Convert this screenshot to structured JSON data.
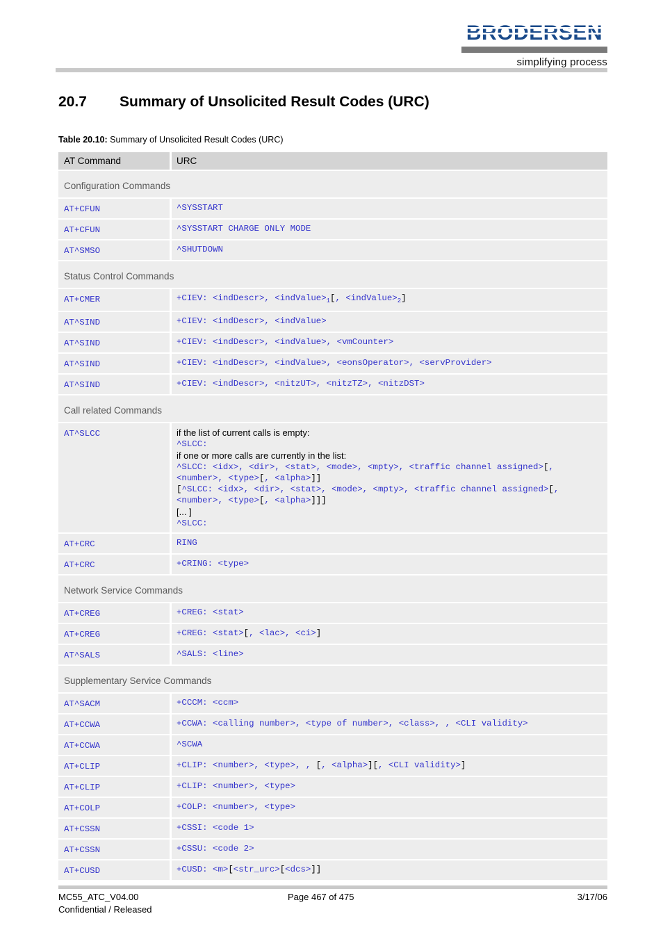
{
  "header": {
    "logo_text": "BRODERSEN",
    "logo_tagline": "simplifying process"
  },
  "title": {
    "number": "20.7",
    "text": "Summary of Unsolicited Result Codes (URC)"
  },
  "caption": {
    "label": "Table 20.10:",
    "text": "Summary of Unsolicited Result Codes (URC)"
  },
  "table": {
    "columns": [
      "AT Command",
      "URC"
    ],
    "sections": [
      {
        "title": "Configuration Commands",
        "rows": [
          {
            "command": "AT+CFUN",
            "urc": "^SYSSTART"
          },
          {
            "command": "AT+CFUN",
            "urc": "^SYSSTART CHARGE ONLY MODE"
          },
          {
            "command": "AT^SMSO",
            "urc": "^SHUTDOWN"
          }
        ]
      },
      {
        "title": "Status Control Commands",
        "rows": [
          {
            "command": "AT+CMER",
            "urc": "+CIEV: <indDescr>, <indValue>1[, <indValue>2]"
          },
          {
            "command": "AT^SIND",
            "urc": "+CIEV: <indDescr>, <indValue>"
          },
          {
            "command": "AT^SIND",
            "urc": "+CIEV: <indDescr>, <indValue>, <vmCounter>"
          },
          {
            "command": "AT^SIND",
            "urc": "+CIEV: <indDescr>, <indValue>, <eonsOperator>, <servProvider>"
          },
          {
            "command": "AT^SIND",
            "urc": "+CIEV: <indDescr>, <nitzUT>, <nitzTZ>, <nitzDST>"
          }
        ]
      },
      {
        "title": "Call related Commands",
        "rows": [
          {
            "command": "AT^SLCC",
            "urc_lines": [
              "if the list of current calls is empty:",
              "^SLCC:",
              "if one or more calls are currently in the list:",
              "^SLCC: <idx>, <dir>, <stat>, <mode>, <mpty>, <traffic channel assigned>[, <number>, <type>[, <alpha>]]",
              "[^SLCC: <idx>, <dir>, <stat>, <mode>, <mpty>, <traffic channel assigned>[, <number>, <type>[, <alpha>]]]",
              "[... ]",
              "^SLCC:"
            ]
          },
          {
            "command": "AT+CRC",
            "urc": "RING"
          },
          {
            "command": "AT+CRC",
            "urc": "+CRING: <type>"
          }
        ]
      },
      {
        "title": "Network Service Commands",
        "rows": [
          {
            "command": "AT+CREG",
            "urc": "+CREG: <stat>"
          },
          {
            "command": "AT+CREG",
            "urc": "+CREG: <stat>[, <lac>, <ci>]"
          },
          {
            "command": "AT^SALS",
            "urc": "^SALS: <line>"
          }
        ]
      },
      {
        "title": "Supplementary Service Commands",
        "rows": [
          {
            "command": "AT^SACM",
            "urc": "+CCCM: <ccm>"
          },
          {
            "command": "AT+CCWA",
            "urc": "+CCWA: <calling number>, <type of number>, <class>, , <CLI validity>"
          },
          {
            "command": "AT+CCWA",
            "urc": "^SCWA"
          },
          {
            "command": "AT+CLIP",
            "urc": "+CLIP: <number>, <type>, , [, <alpha>][, <CLI validity>]"
          },
          {
            "command": "AT+CLIP",
            "urc": "+CLIP: <number>, <type>"
          },
          {
            "command": "AT+COLP",
            "urc": "+COLP: <number>, <type>"
          },
          {
            "command": "AT+CSSN",
            "urc": "+CSSI: <code 1>"
          },
          {
            "command": "AT+CSSN",
            "urc": "+CSSU: <code 2>"
          },
          {
            "command": "AT+CUSD",
            "urc": "+CUSD: <m>[<str_urc>[<dcs>]]"
          }
        ]
      }
    ]
  },
  "footer": {
    "document_id": "MC55_ATC_V04.00",
    "page": "Page 467 of 475",
    "date": "3/17/06",
    "classification": "Confidential / Released"
  },
  "colors": {
    "code_blue": "#3333cc",
    "logo_blue": "#1a4a8a",
    "row_bg": "#ededed",
    "header_bg": "#d4d4d4",
    "section_text": "#595959"
  }
}
